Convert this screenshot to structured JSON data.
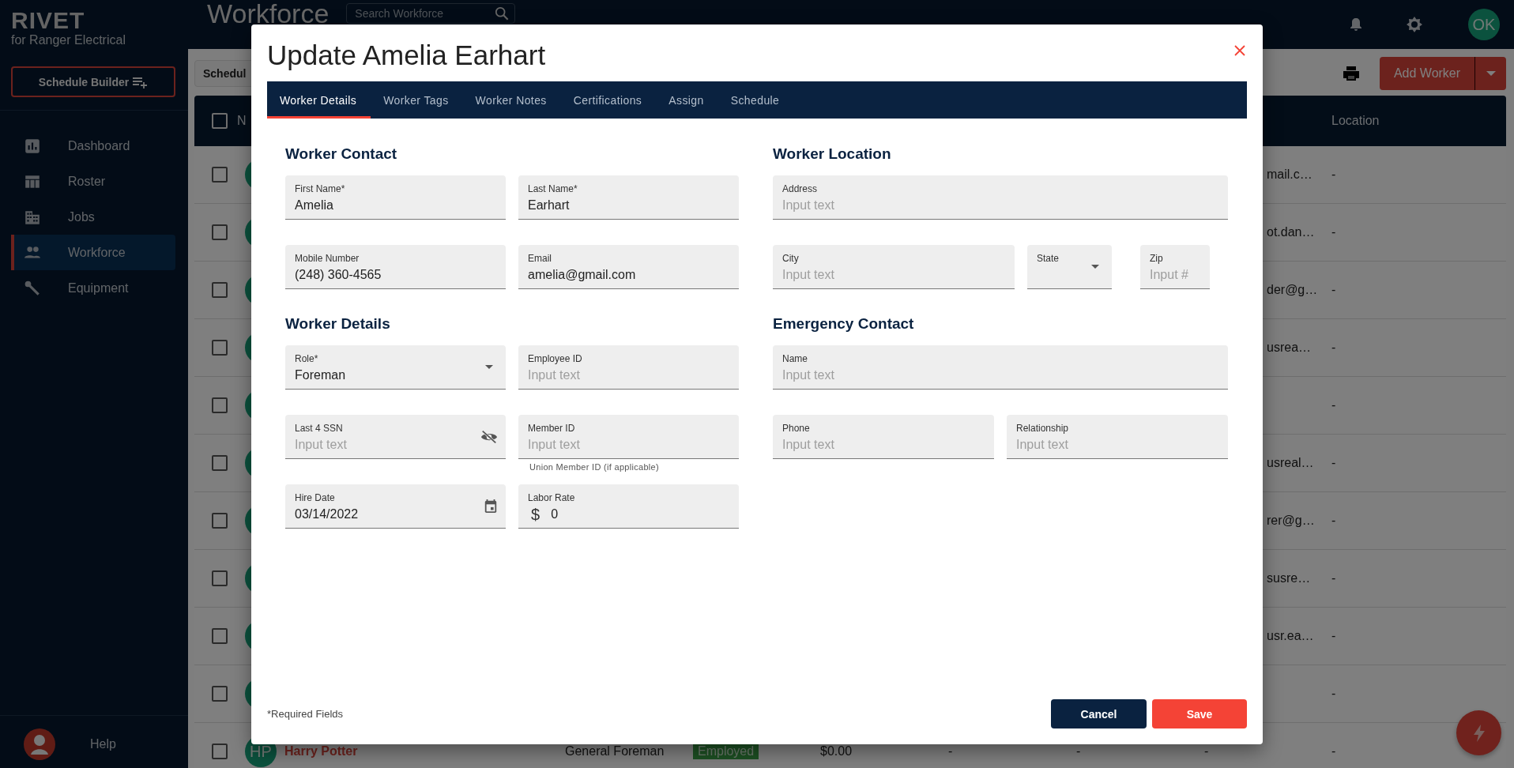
{
  "sidebar": {
    "logo": "RIVET",
    "subtitle": "for Ranger Electrical",
    "schedule_button": "Schedule Builder",
    "items": [
      {
        "label": "Dashboard",
        "kind": "chart",
        "selected": false
      },
      {
        "label": "Roster",
        "kind": "table",
        "selected": false
      },
      {
        "label": "Jobs",
        "kind": "building",
        "selected": false
      },
      {
        "label": "Workforce",
        "kind": "people",
        "selected": true
      },
      {
        "label": "Equipment",
        "kind": "wrench",
        "selected": false
      }
    ],
    "help": "Help"
  },
  "topbar": {
    "title": "Workforce",
    "search_placeholder": "Search Workforce",
    "avatar": "OK"
  },
  "toolbar": {
    "partial_button": "Schedul",
    "add_button": "Add Worker"
  },
  "table": {
    "header_checked": false,
    "columns": [
      "N",
      "Location"
    ],
    "rows": [
      {
        "checked": false,
        "email": "mail.c…",
        "location": "-"
      },
      {
        "checked": false,
        "email": "ot.dan…",
        "location": "-"
      },
      {
        "checked": false,
        "email": "der@g…",
        "location": "-"
      },
      {
        "checked": false,
        "email": "usrea…",
        "location": "-"
      },
      {
        "checked": false,
        "location": "-"
      },
      {
        "checked": false,
        "email": "usreal…",
        "location": "-"
      },
      {
        "checked": false,
        "email": "rer@g…",
        "location": "-"
      },
      {
        "checked": false,
        "email": "susre…",
        "location": "-"
      },
      {
        "checked": false,
        "email": "usr.ea…",
        "location": "-"
      },
      {
        "checked": false,
        "location": "-"
      },
      {
        "checked": false,
        "initials": "HP",
        "name": "Harry Potter",
        "role": "General Foreman",
        "status": "Employed",
        "rate": "$0.00",
        "column_7": "-",
        "column_8": "-",
        "column_9": "-",
        "location": "-"
      }
    ]
  },
  "modal": {
    "title": "Update Amelia Earhart",
    "tabs": [
      {
        "label": "Worker Details",
        "selected": true
      },
      {
        "label": "Worker Tags",
        "selected": false
      },
      {
        "label": "Worker Notes",
        "selected": false
      },
      {
        "label": "Certifications",
        "selected": false
      },
      {
        "label": "Assign",
        "selected": false
      },
      {
        "label": "Schedule",
        "selected": false
      }
    ],
    "columns": [
      [
        {
          "title": "Worker Contact",
          "rows": [
            [
              {
                "label": "First Name*",
                "kind": "text",
                "value": "Amelia"
              },
              {
                "label": "Last Name*",
                "kind": "text",
                "value": "Earhart"
              }
            ],
            [
              {
                "label": "Mobile Number",
                "kind": "text",
                "value": "(248) 360-4565"
              },
              {
                "label": "Email",
                "kind": "text",
                "value": "amelia@gmail.com"
              }
            ]
          ]
        },
        {
          "title": "Worker Details",
          "rows": [
            [
              {
                "label": "Role*",
                "kind": "select",
                "value": "Foreman"
              },
              {
                "label": "Employee ID",
                "kind": "text",
                "placeholder": "Input text"
              }
            ],
            [
              {
                "label": "Last 4 SSN",
                "kind": "password",
                "placeholder": "Input text"
              },
              {
                "label": "Member ID",
                "kind": "text",
                "placeholder": "Input text",
                "helper": "Union Member ID (if applicable)"
              }
            ],
            [
              {
                "label": "Hire Date",
                "kind": "date",
                "value": "03/14/2022"
              },
              {
                "label": "Labor Rate",
                "kind": "currency",
                "prefix": "$",
                "value": "0"
              }
            ]
          ]
        }
      ],
      [
        {
          "title": "Worker Location",
          "rows": [
            [
              {
                "label": "Address",
                "kind": "text",
                "placeholder": "Input text"
              }
            ],
            [
              {
                "label": "City",
                "kind": "text",
                "placeholder": "Input text"
              },
              {
                "label": "State",
                "kind": "select"
              },
              {
                "label": "Zip",
                "kind": "text",
                "placeholder": "Input #"
              }
            ]
          ]
        },
        {
          "title": "Emergency Contact",
          "rows": [
            [
              {
                "label": "Name",
                "kind": "text",
                "placeholder": "Input text"
              }
            ],
            [
              {
                "label": "Phone",
                "kind": "text",
                "placeholder": "Input text"
              },
              {
                "label": "Relationship",
                "kind": "text",
                "placeholder": "Input text"
              }
            ]
          ]
        }
      ]
    ],
    "required_note": "*Required Fields",
    "cancel": "Cancel",
    "save": "Save"
  }
}
